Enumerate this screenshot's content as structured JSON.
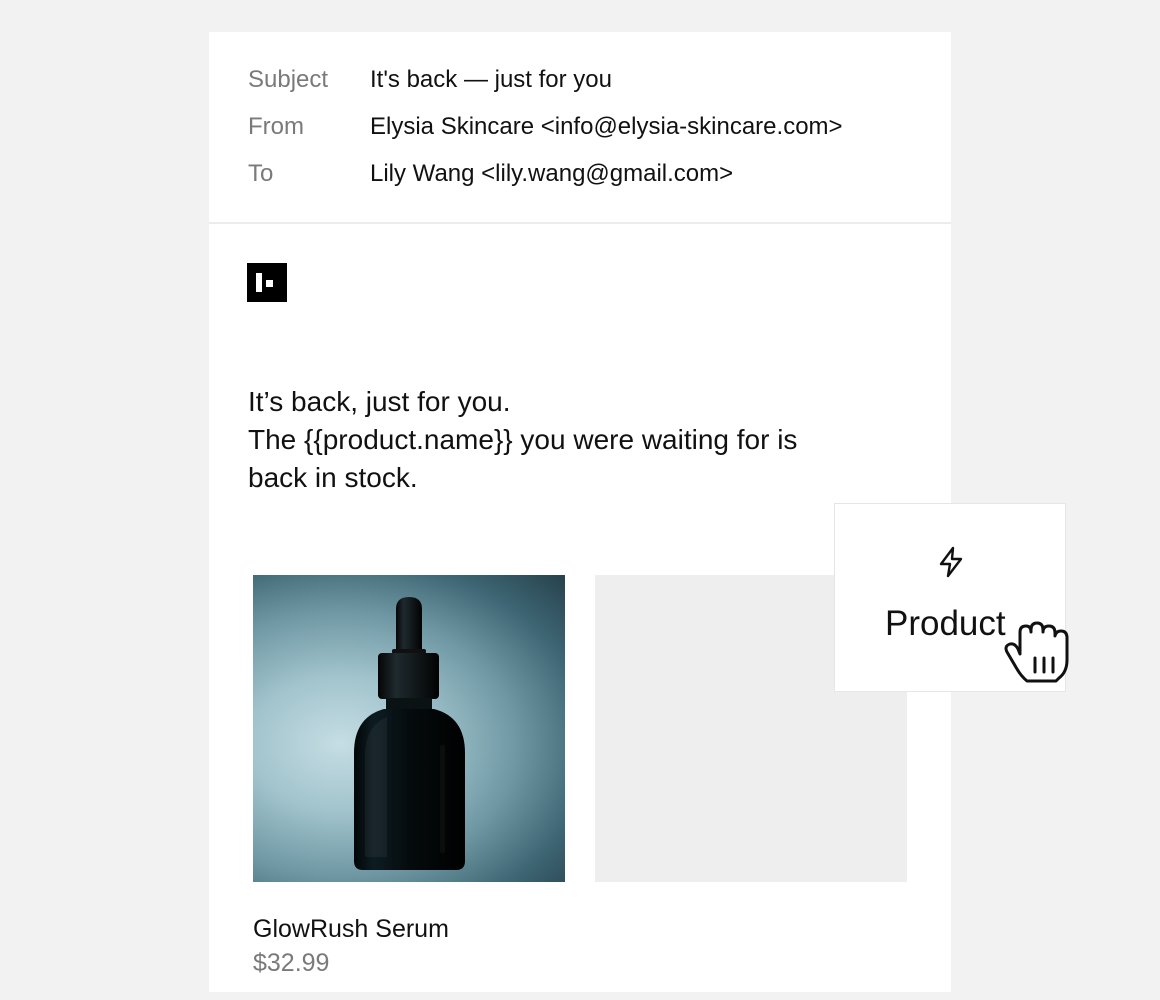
{
  "email": {
    "subject_label": "Subject",
    "subject_value": "It's back — just for you",
    "from_label": "From",
    "from_value": "Elysia Skincare <info@elysia-skincare.com>",
    "to_label": "To",
    "to_value": "Lily Wang <lily.wang@gmail.com>"
  },
  "content": {
    "logo_icon": "brand-logo-icon",
    "lines": [
      "It’s back, just for you.",
      "The {{product.name}} you were waiting for is",
      "back in stock."
    ]
  },
  "products": [
    {
      "name": "GlowRush Serum",
      "price": "$32.99",
      "image": "dropper-bottle-photo"
    },
    {
      "placeholder": true
    }
  ],
  "drag_block": {
    "icon": "lightning-bolt-icon",
    "label": "Product",
    "cursor": "grab-hand-cursor-icon"
  },
  "colors": {
    "page_background": "#f2f2f2",
    "card_background": "#ffffff",
    "label_gray": "#7a7a7a",
    "text": "#111111",
    "placeholder_gray": "#eeeeee"
  }
}
